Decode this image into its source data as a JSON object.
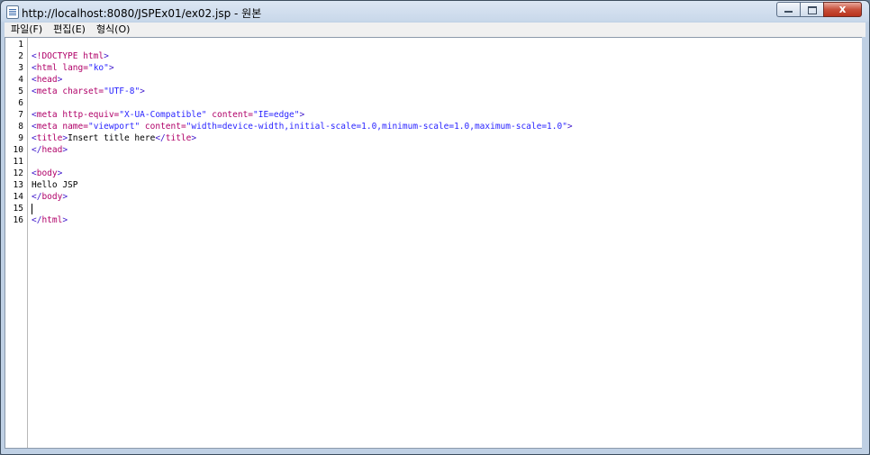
{
  "window": {
    "title": "http://localhost:8080/JSPEx01/ex02.jsp - 원본",
    "buttons": {
      "minimize": "minimize-icon",
      "maximize": "maximize-icon",
      "close": "close-icon",
      "close_glyph": "x"
    }
  },
  "menu": [
    {
      "label": "파일(F)"
    },
    {
      "label": "편집(E)"
    },
    {
      "label": "형식(O)"
    }
  ],
  "editor": {
    "line_numbers": [
      "1",
      "2",
      "3",
      "4",
      "5",
      "6",
      "7",
      "8",
      "9",
      "10",
      "11",
      "12",
      "13",
      "14",
      "15",
      "16"
    ],
    "lines": [
      [],
      [
        {
          "t": "<",
          "c": "tag"
        },
        {
          "t": "!DOCTYPE html",
          "c": "tagname"
        },
        {
          "t": ">",
          "c": "tag"
        }
      ],
      [
        {
          "t": "<",
          "c": "tag"
        },
        {
          "t": "html",
          "c": "tagname"
        },
        {
          "t": " ",
          "c": "txt"
        },
        {
          "t": "lang=",
          "c": "attr"
        },
        {
          "t": "\"ko\"",
          "c": "val"
        },
        {
          "t": ">",
          "c": "tag"
        }
      ],
      [
        {
          "t": "<",
          "c": "tag"
        },
        {
          "t": "head",
          "c": "tagname"
        },
        {
          "t": ">",
          "c": "tag"
        }
      ],
      [
        {
          "t": "<",
          "c": "tag"
        },
        {
          "t": "meta",
          "c": "tagname"
        },
        {
          "t": " ",
          "c": "txt"
        },
        {
          "t": "charset=",
          "c": "attr"
        },
        {
          "t": "\"UTF-8\"",
          "c": "val"
        },
        {
          "t": ">",
          "c": "tag"
        }
      ],
      [],
      [
        {
          "t": "<",
          "c": "tag"
        },
        {
          "t": "meta",
          "c": "tagname"
        },
        {
          "t": " ",
          "c": "txt"
        },
        {
          "t": "http-equiv=",
          "c": "attr"
        },
        {
          "t": "\"X-UA-Compatible\"",
          "c": "val"
        },
        {
          "t": " ",
          "c": "txt"
        },
        {
          "t": "content=",
          "c": "attr"
        },
        {
          "t": "\"IE=edge\"",
          "c": "val"
        },
        {
          "t": ">",
          "c": "tag"
        }
      ],
      [
        {
          "t": "<",
          "c": "tag"
        },
        {
          "t": "meta",
          "c": "tagname"
        },
        {
          "t": " ",
          "c": "txt"
        },
        {
          "t": "name=",
          "c": "attr"
        },
        {
          "t": "\"viewport\"",
          "c": "val"
        },
        {
          "t": " ",
          "c": "txt"
        },
        {
          "t": "content=",
          "c": "attr"
        },
        {
          "t": "\"width=device-width,initial-scale=1.0,minimum-scale=1.0,maximum-scale=1.0\"",
          "c": "val"
        },
        {
          "t": ">",
          "c": "tag"
        }
      ],
      [
        {
          "t": "<",
          "c": "tag"
        },
        {
          "t": "title",
          "c": "tagname"
        },
        {
          "t": ">",
          "c": "tag"
        },
        {
          "t": "Insert title here",
          "c": "txt"
        },
        {
          "t": "</",
          "c": "tag"
        },
        {
          "t": "title",
          "c": "tagname"
        },
        {
          "t": ">",
          "c": "tag"
        }
      ],
      [
        {
          "t": "</",
          "c": "tag"
        },
        {
          "t": "head",
          "c": "tagname"
        },
        {
          "t": ">",
          "c": "tag"
        }
      ],
      [],
      [
        {
          "t": "<",
          "c": "tag"
        },
        {
          "t": "body",
          "c": "tagname"
        },
        {
          "t": ">",
          "c": "tag"
        }
      ],
      [
        {
          "t": "Hello JSP",
          "c": "txt"
        }
      ],
      [
        {
          "t": "</",
          "c": "tag"
        },
        {
          "t": "body",
          "c": "tagname"
        },
        {
          "t": ">",
          "c": "tag"
        }
      ],
      [],
      [
        {
          "t": "</",
          "c": "tag"
        },
        {
          "t": "html",
          "c": "tagname"
        },
        {
          "t": ">",
          "c": "tag"
        }
      ]
    ],
    "cursor_line": 15
  },
  "colors": {
    "tag_bracket": "#3f18cc",
    "tag_name": "#b00068",
    "attribute": "#b00068",
    "attribute_value": "#2a24ff",
    "text": "#000000"
  }
}
